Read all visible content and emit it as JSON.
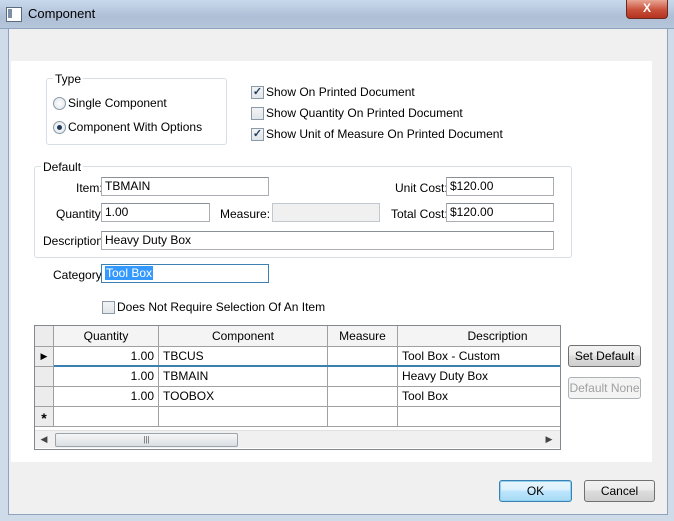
{
  "window": {
    "title": "Component",
    "close_glyph": "X"
  },
  "type_group": {
    "legend": "Type",
    "options": [
      {
        "label": "Single Component",
        "selected": false
      },
      {
        "label": "Component With Options",
        "selected": true
      }
    ]
  },
  "show_options": [
    {
      "label": "Show On Printed Document",
      "checked": true
    },
    {
      "label": "Show Quantity On Printed Document",
      "checked": false
    },
    {
      "label": "Show Unit of Measure On Printed Document",
      "checked": true
    }
  ],
  "default_group": {
    "legend": "Default",
    "item_label": "Item:",
    "item_value": "TBMAIN",
    "quantity_label": "Quantity:",
    "quantity_value": "1.00",
    "measure_label": "Measure:",
    "measure_value": "",
    "unit_cost_label": "Unit Cost:",
    "unit_cost_value": "$120.00",
    "total_cost_label": "Total Cost:",
    "total_cost_value": "$120.00",
    "description_label": "Description:",
    "description_value": "Heavy Duty Box"
  },
  "category": {
    "label": "Category:",
    "value": "Tool Box"
  },
  "no_selection": {
    "label": "Does Not Require Selection Of An Item",
    "checked": false
  },
  "grid": {
    "columns": [
      "Quantity",
      "Component",
      "Measure",
      "Description"
    ],
    "rows": [
      {
        "quantity": "1.00",
        "component": "TBCUS",
        "measure": "",
        "description": "Tool Box - Custom",
        "current": true
      },
      {
        "quantity": "1.00",
        "component": "TBMAIN",
        "measure": "",
        "description": "Heavy Duty Box",
        "current": false
      },
      {
        "quantity": "1.00",
        "component": "TOOBOX",
        "measure": "",
        "description": "Tool Box",
        "current": false
      }
    ],
    "new_row_marker": "*",
    "current_row_marker": "▶",
    "scroll_left": "◀",
    "scroll_right": "▶",
    "thumb_grip": "|||"
  },
  "side_buttons": {
    "set_default": "Set Default",
    "default_none": "Default None"
  },
  "footer": {
    "ok": "OK",
    "cancel": "Cancel"
  },
  "colors": {
    "selection": "#3399ff",
    "current_row_line": "#3c7fb1"
  }
}
